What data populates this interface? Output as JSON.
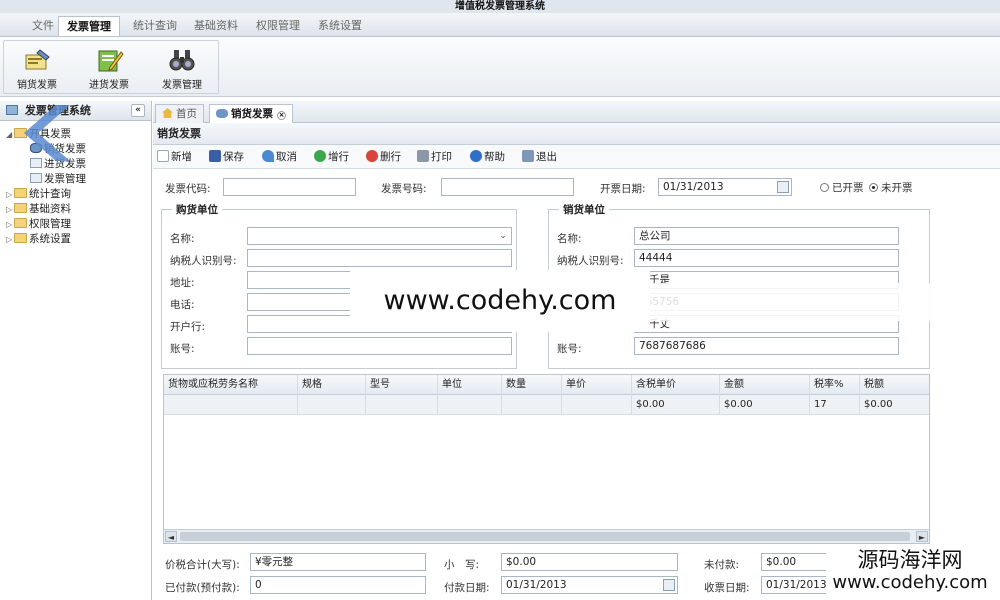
{
  "window": {
    "title": "增值税发票管理系统"
  },
  "menu": {
    "items": [
      {
        "label": "文件",
        "active": false
      },
      {
        "label": "发票管理",
        "active": true
      },
      {
        "label": "统计查询",
        "active": false
      },
      {
        "label": "基础资料",
        "active": false
      },
      {
        "label": "权限管理",
        "active": false
      },
      {
        "label": "系统设置",
        "active": false
      }
    ]
  },
  "ribbon": {
    "buttons": [
      {
        "label": "销货发票",
        "icon": "invoice-edit-icon"
      },
      {
        "label": "进货发票",
        "icon": "pencil-note-icon"
      },
      {
        "label": "发票管理",
        "icon": "binoculars-icon"
      }
    ]
  },
  "sidebar": {
    "title": "发票管理系统",
    "collapse_label": "«",
    "tree": {
      "group1": {
        "label": "开具发票",
        "expanded": true
      },
      "children": [
        "销货发票",
        "进货发票",
        "发票管理"
      ],
      "group2": "统计查询",
      "group3": "基础资料",
      "group4": "权限管理",
      "group5": "系统设置"
    }
  },
  "tabs": [
    {
      "label": "首页",
      "active": false
    },
    {
      "label": "销货发票",
      "active": true
    }
  ],
  "panel": {
    "title": "销货发票"
  },
  "toolbar": {
    "new": "新增",
    "save": "保存",
    "cancel": "取消",
    "add_row": "增行",
    "delete_row": "删行",
    "print": "打印",
    "help": "帮助",
    "exit": "退出"
  },
  "invoice": {
    "code_label": "发票代码:",
    "code_value": "",
    "number_label": "发票号码:",
    "number_value": "",
    "date_label": "开票日期:",
    "date_value": "01/31/2013",
    "status_issued": "已开票",
    "status_unissued": "未开票",
    "status_selected": "未开票"
  },
  "buyer": {
    "legend": "购货单位",
    "name_label": "名称:",
    "name_value": "",
    "taxid_label": "纳税人识别号:",
    "taxid_value": "",
    "address_label": "地址:",
    "address_value": "",
    "phone_label": "电话:",
    "phone_value": "",
    "bank_label": "开户行:",
    "bank_value": "",
    "account_label": "账号:",
    "account_value": ""
  },
  "seller": {
    "legend": "销货单位",
    "name_label": "名称:",
    "name_value": "总公司",
    "taxid_label": "纳税人识别号:",
    "taxid_value": "44444",
    "address_value": "千是",
    "phone_value": "765756",
    "bank_value": "千丈",
    "account_label": "账号:",
    "account_value": "7687687686"
  },
  "grid": {
    "columns": [
      "货物或应税劳务名称",
      "规格",
      "型号",
      "单位",
      "数量",
      "单价",
      "含税单价",
      "金额",
      "税率%",
      "税额"
    ],
    "rows": [
      [
        "",
        "",
        "",
        "",
        "",
        "",
        "$0.00",
        "$0.00",
        "17",
        "$0.00"
      ]
    ],
    "scroll_left": "◄",
    "scroll_right": "►"
  },
  "totals": {
    "total_upper_label": "价税合计(大写):",
    "total_upper_value": "¥零元整",
    "total_lower_label": "小　写:",
    "total_lower_value": "$0.00",
    "unpaid_label": "未付款:",
    "unpaid_value": "$0.00",
    "paid_label": "已付款(预付款):",
    "paid_value": "0",
    "pay_date_label": "付款日期:",
    "pay_date_value": "01/31/2013",
    "receive_date_label": "收票日期:",
    "receive_date_value": "01/31/2013"
  },
  "watermarks": {
    "center": "www.codehy.com",
    "corner_line1": "源码海洋网",
    "corner_line2": "www.codehy.com"
  },
  "colors": {
    "accent": "#3a6fb0",
    "border": "#b9c4cf",
    "header_bg": "#dfe6ee"
  }
}
